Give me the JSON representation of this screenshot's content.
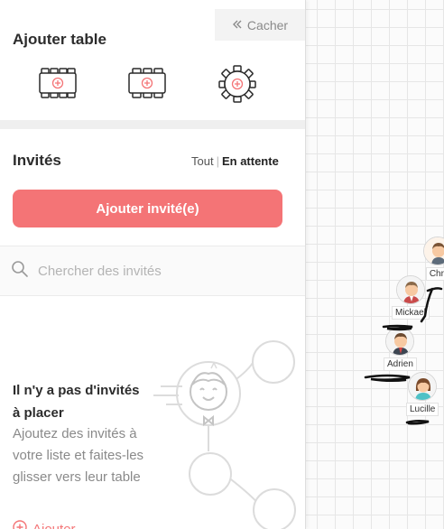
{
  "panel": {
    "hide_label": "Cacher",
    "add_table_title": "Ajouter table",
    "guests_title": "Invités",
    "filter_all": "Tout",
    "filter_separator": "|",
    "filter_pending": "En attente",
    "add_guest_label": "Ajouter invité(e)",
    "search_placeholder": "Chercher des invités",
    "empty_title": "Il n'y a pas d'invités à placer",
    "empty_description": "Ajoutez des invités à votre liste et faites-les glisser vers leur table",
    "add_link_label": "Ajouter"
  },
  "table_types": [
    {
      "icon": "rectangular-table-8-icon"
    },
    {
      "icon": "rectangular-table-6-icon"
    },
    {
      "icon": "round-table-icon"
    }
  ],
  "guests": [
    {
      "name": "Chri",
      "icon": "male-avatar-icon"
    },
    {
      "name": "Mickael",
      "icon": "male-avatar-icon"
    },
    {
      "name": "Adrien",
      "icon": "male-avatar-icon"
    },
    {
      "name": "Lucille",
      "icon": "female-avatar-icon"
    }
  ],
  "colors": {
    "accent": "#f47476",
    "grid_line": "#e6e6e6",
    "muted_text": "#8a8a8a"
  }
}
